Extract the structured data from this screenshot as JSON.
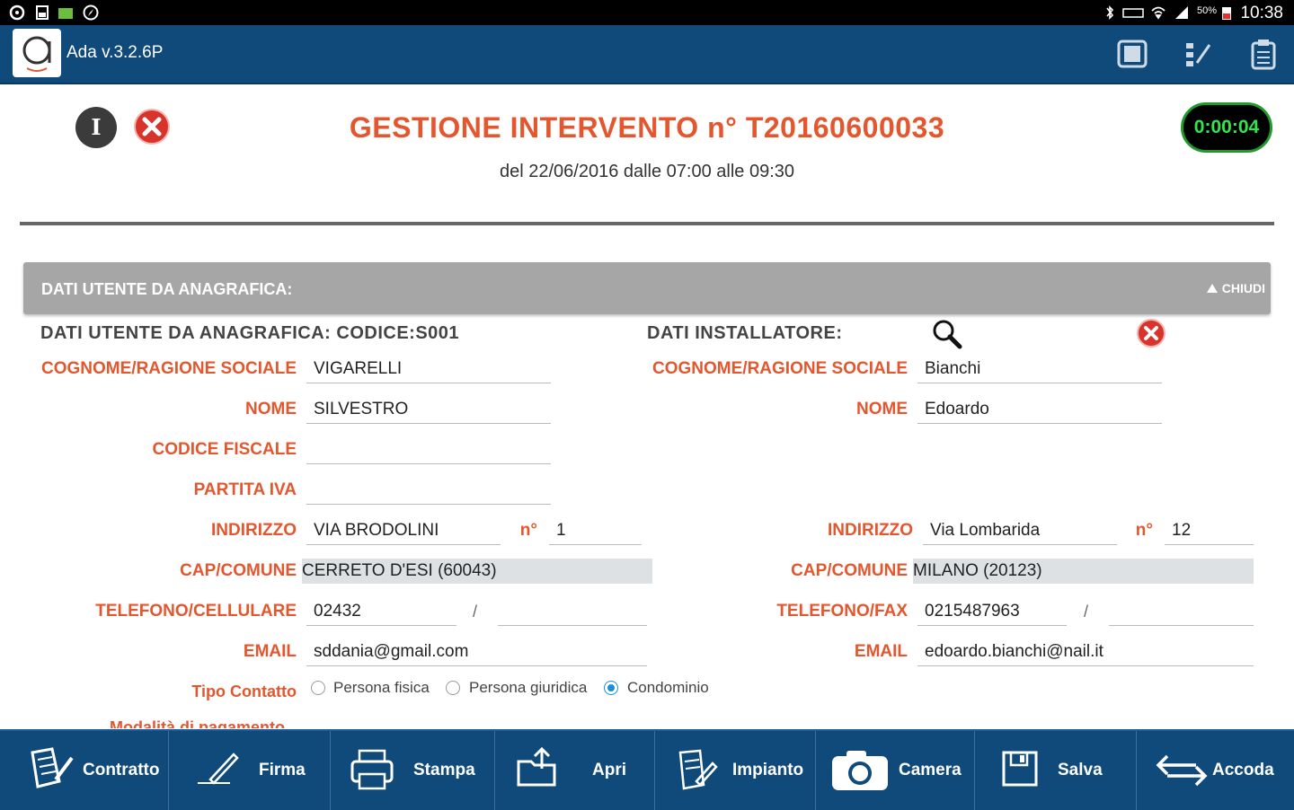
{
  "status_bar": {
    "time": "10:38",
    "battery": "50%"
  },
  "app": {
    "title": "Ada v.3.2.6P"
  },
  "header": {
    "title": "GESTIONE INTERVENTO n° T20160600033",
    "subtitle": "del 22/06/2016 dalle 07:00 alle 09:30",
    "timer": "0:00:04",
    "info_glyph": "I"
  },
  "section": {
    "label": "DATI UTENTE DA ANAGRAFICA:",
    "collapse_label": "CHIUDI"
  },
  "cliente": {
    "header": "DATI UTENTE DA ANAGRAFICA:  CODICE:S001",
    "labels": {
      "cognome": "COGNOME/RAGIONE SOCIALE",
      "nome": "NOME",
      "codice_fiscale": "CODICE FISCALE",
      "partita_iva": "PARTITA IVA",
      "indirizzo": "INDIRIZZO",
      "numero": "n°",
      "cap": "CAP/COMUNE",
      "telefono": "TELEFONO/CELLULARE",
      "email": "EMAIL",
      "tipo": "Tipo Contatto",
      "modalita": "Modalità di pagamento"
    },
    "values": {
      "cognome": "VIGARELLI",
      "nome": "SILVESTRO",
      "codice_fiscale": "",
      "partita_iva": "",
      "indirizzo": "VIA BRODOLINI",
      "numero": "1",
      "cap": "CERRETO D'ESI (60043)",
      "telefono": "02432",
      "cellulare": "",
      "email": "sddania@gmail.com"
    },
    "tipo_options": [
      "Persona fisica",
      "Persona giuridica",
      "Condominio"
    ],
    "tipo_selected": "Condominio"
  },
  "installatore": {
    "header": "DATI INSTALLATORE:",
    "labels": {
      "cognome": "COGNOME/RAGIONE SOCIALE",
      "nome": "NOME",
      "indirizzo": "INDIRIZZO",
      "numero": "n°",
      "cap": "CAP/COMUNE",
      "telefono": "TELEFONO/FAX",
      "email": "EMAIL"
    },
    "values": {
      "cognome": "Bianchi",
      "nome": "Edoardo",
      "indirizzo": "Via Lombarida",
      "numero": "12",
      "cap": "MILANO (20123)",
      "telefono": "0215487963",
      "fax": "",
      "email": "edoardo.bianchi@nail.it"
    }
  },
  "toolbar": [
    {
      "label": "Contratto",
      "icon": "contract-icon"
    },
    {
      "label": "Firma",
      "icon": "pen-icon"
    },
    {
      "label": "Stampa",
      "icon": "printer-icon"
    },
    {
      "label": "Apri",
      "icon": "folder-open-icon"
    },
    {
      "label": "Impianto",
      "icon": "document-edit-icon"
    },
    {
      "label": "Camera",
      "icon": "camera-icon"
    },
    {
      "label": "Salva",
      "icon": "save-icon"
    },
    {
      "label": "Accoda",
      "icon": "swap-arrows-icon"
    }
  ],
  "colors": {
    "accent": "#e4572e",
    "appbar": "#0f4a7a",
    "timer_text": "#31e64a",
    "radio_selected": "#1a8fd9"
  }
}
